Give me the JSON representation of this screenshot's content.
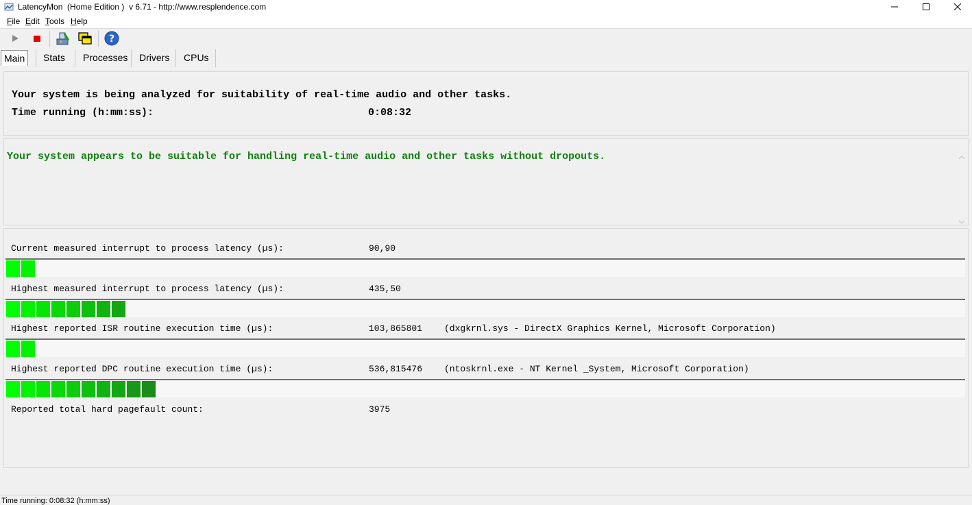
{
  "window": {
    "title": "LatencyMon  (Home Edition )  v 6.71 - http://www.resplendence.com"
  },
  "menu": [
    {
      "label": "File",
      "accel": "F",
      "rest": "ile"
    },
    {
      "label": "Edit",
      "accel": "E",
      "rest": "dit"
    },
    {
      "label": "Tools",
      "accel": "T",
      "rest": "ools"
    },
    {
      "label": "Help",
      "accel": "H",
      "rest": "elp"
    }
  ],
  "toolbar": {
    "icons": [
      "play-icon",
      "stop-icon",
      "analyze-icon",
      "windows-icon",
      "help-icon"
    ]
  },
  "tabs": [
    {
      "label": "Main",
      "active": true
    },
    {
      "label": "Stats",
      "active": false
    },
    {
      "label": "Processes",
      "active": false
    },
    {
      "label": "Drivers",
      "active": false
    },
    {
      "label": "CPUs",
      "active": false
    }
  ],
  "header": {
    "analyzing": "Your system is being analyzed for suitability of real-time audio and other tasks.",
    "time_label": "Time running (h:mm:ss):",
    "time_value": "0:08:32"
  },
  "verdict": {
    "text": "Your system appears to be suitable for handling real-time audio and other tasks without dropouts.",
    "color": "#108010"
  },
  "metrics": [
    {
      "label": "Current measured interrupt to process latency (µs):",
      "value": "90,90",
      "info": "",
      "bar_segments": 2
    },
    {
      "label": "Highest measured interrupt to process latency (µs):",
      "value": "435,50",
      "info": "",
      "bar_segments": 8
    },
    {
      "label": "Highest reported ISR routine execution time (µs):",
      "value": "103,865801",
      "info": "(dxgkrnl.sys - DirectX Graphics Kernel, Microsoft Corporation)",
      "bar_segments": 2
    },
    {
      "label": "Highest reported DPC routine execution time (µs):",
      "value": "536,815476",
      "info": "(ntoskrnl.exe - NT Kernel _System, Microsoft Corporation)",
      "bar_segments": 10
    },
    {
      "label": "Reported total hard pagefault count:",
      "value": "3975",
      "info": ""
    }
  ],
  "colors": {
    "bar_bright": "#00ff00",
    "bar_dark": "#1a8c1a"
  },
  "statusbar": {
    "text": "Time running: 0:08:32  (h:mm:ss)"
  }
}
